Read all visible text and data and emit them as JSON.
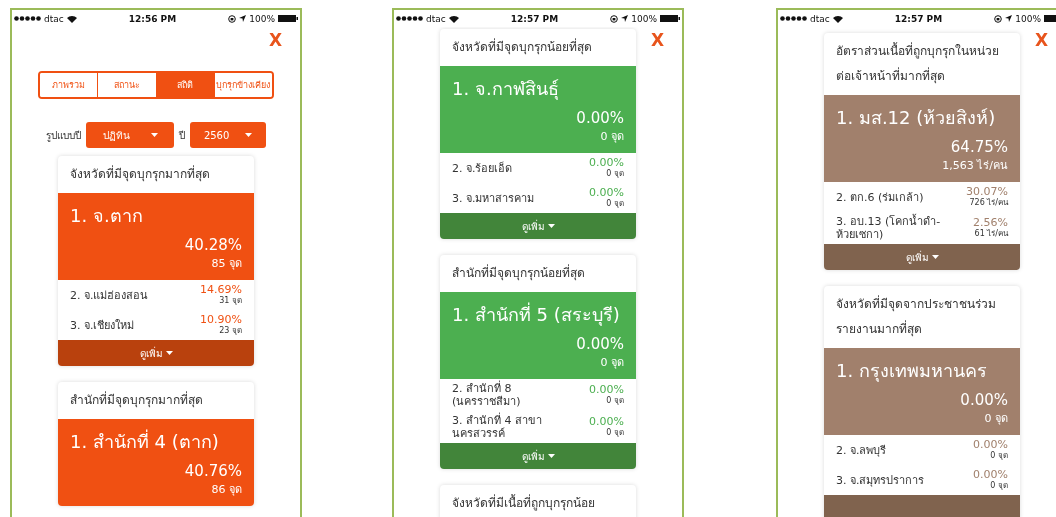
{
  "phones": [
    {
      "status": {
        "carrier": "dtac",
        "time": "12:56 PM",
        "battery": "100%"
      },
      "close": "X",
      "tabs": [
        {
          "label": "ภาพรวม",
          "selected": false
        },
        {
          "label": "สถานะ",
          "selected": false
        },
        {
          "label": "สถิติ",
          "selected": true
        },
        {
          "label": "บุกรุกข้างเคียง",
          "selected": false
        }
      ],
      "filters": [
        {
          "label": "รูปแบบปี",
          "value": "ปฏิทิน"
        },
        {
          "label": "ปี",
          "value": "2560"
        }
      ],
      "cards": [
        {
          "title": "จังหวัดที่มีจุดบุกรุกมากที่สุด",
          "color": "#f05012",
          "top": {
            "name": "1. จ.ตาก",
            "percent": "40.28%",
            "count": "85 จุด"
          },
          "rows": [
            {
              "name": "2. จ.แม่ฮ่องสอน",
              "percent": "14.69%",
              "count": "31 จุด"
            },
            {
              "name": "3. จ.เชียงใหม่",
              "percent": "10.90%",
              "count": "23 จุด"
            }
          ],
          "more": "ดูเพิ่ม"
        },
        {
          "title": "สำนักที่มีจุดบุกรุกมากที่สุด",
          "color": "#f05012",
          "top": {
            "name": "1. สำนักที่ 4 (ตาก)",
            "percent": "40.76%",
            "count": "86 จุด"
          }
        }
      ]
    },
    {
      "status": {
        "carrier": "dtac",
        "time": "12:57 PM",
        "battery": "100%"
      },
      "close": "X",
      "cards": [
        {
          "title": "จังหวัดที่มีจุดบุกรุกน้อยที่สุด",
          "color": "#4caf50",
          "top": {
            "name": "1. จ.กาฬสินธุ์",
            "percent": "0.00%",
            "count": "0 จุด"
          },
          "rows": [
            {
              "name": "2. จ.ร้อยเอ็ด",
              "percent": "0.00%",
              "count": "0 จุด"
            },
            {
              "name": "3. จ.มหาสารคาม",
              "percent": "0.00%",
              "count": "0 จุด"
            }
          ],
          "more": "ดูเพิ่ม"
        },
        {
          "title": "สำนักที่มีจุดบุกรุกน้อยที่สุด",
          "color": "#4caf50",
          "top": {
            "name": "1. สำนักที่ 5 (สระบุรี)",
            "percent": "0.00%",
            "count": "0 จุด"
          },
          "rows": [
            {
              "name": "2. สำนักที่ 8 (นครราชสีมา)",
              "percent": "0.00%",
              "count": "0 จุด"
            },
            {
              "name": "3. สำนักที่ 4 สาขา นครสวรรค์",
              "percent": "0.00%",
              "count": "0 จุด"
            }
          ],
          "more": "ดูเพิ่ม"
        },
        {
          "title": "จังหวัดที่มีเนื้อที่ถูกบุกรุกน้อย"
        }
      ]
    },
    {
      "status": {
        "carrier": "dtac",
        "time": "12:57 PM",
        "battery": "100%"
      },
      "close": "X",
      "cards": [
        {
          "title": "อัตราส่วนเนื้อที่ถูกบุกรุกในหน่วยต่อเจ้าหน้าที่มากที่สุด",
          "color": "#a1806c",
          "top": {
            "name": "1. มส.12 (ห้วยสิงห์)",
            "percent": "64.75%",
            "count": "1,563 ไร่/คน"
          },
          "rows": [
            {
              "name": "2. ตก.6 (ร่มเกล้า)",
              "percent": "30.07%",
              "count": "726 ไร่/คน"
            },
            {
              "name": "3. อบ.13 (โคกน้ำดำ-ห้วยเซกา)",
              "percent": "2.56%",
              "count": "61 ไร่/คน"
            }
          ],
          "more": "ดูเพิ่ม"
        },
        {
          "title": "จังหวัดที่มีจุดจากประชาชนร่วมรายงานมากที่สุด",
          "color": "#a1806c",
          "top": {
            "name": "1. กรุงเทพมหานคร",
            "percent": "0.00%",
            "count": "0 จุด"
          },
          "rows": [
            {
              "name": "2. จ.ลพบุรี",
              "percent": "0.00%",
              "count": "0 จุด"
            },
            {
              "name": "3. จ.สมุทรปราการ",
              "percent": "0.00%",
              "count": "0 จุด"
            }
          ],
          "more_bar": true
        }
      ]
    }
  ]
}
